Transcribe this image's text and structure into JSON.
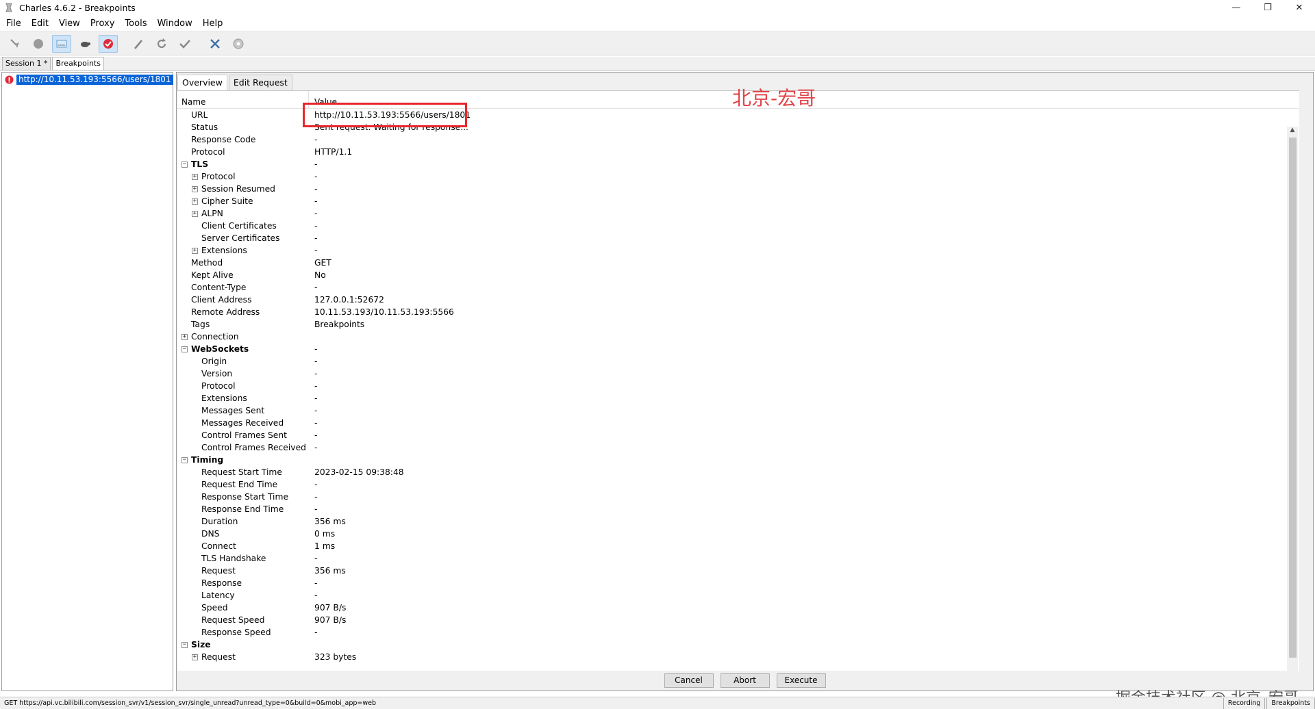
{
  "window": {
    "title": "Charles 4.6.2 - Breakpoints",
    "controls": [
      "minimize",
      "restore",
      "close"
    ]
  },
  "menu": [
    "File",
    "Edit",
    "View",
    "Proxy",
    "Tools",
    "Window",
    "Help"
  ],
  "toolbar": {
    "icons": [
      "broom-icon",
      "record-icon",
      "throttle-icon",
      "turtle-icon",
      "breakpoint-icon",
      "pen-icon",
      "refresh-icon",
      "check-icon",
      "tools-icon",
      "settings-icon"
    ]
  },
  "top_tabs": [
    "Session 1 *",
    "Breakpoints"
  ],
  "left_tree": {
    "url": "http://10.11.53.193:5566/users/1801"
  },
  "sub_tabs": [
    "Overview",
    "Edit Request"
  ],
  "table": {
    "name_header": "Name",
    "value_header": "Value",
    "rows": [
      {
        "name": "URL",
        "value": "http://10.11.53.193:5566/users/1801",
        "indent": 1,
        "expander": "none",
        "bold": false
      },
      {
        "name": "Status",
        "value": "Sent request. Waiting for response...",
        "indent": 1,
        "expander": "none",
        "bold": false
      },
      {
        "name": "Response Code",
        "value": "-",
        "indent": 1,
        "expander": "none",
        "bold": false
      },
      {
        "name": "Protocol",
        "value": "HTTP/1.1",
        "indent": 1,
        "expander": "none",
        "bold": false
      },
      {
        "name": "TLS",
        "value": "-",
        "indent": 0,
        "expander": "minus",
        "bold": true
      },
      {
        "name": "Protocol",
        "value": "-",
        "indent": 1,
        "expander": "plus",
        "bold": false
      },
      {
        "name": "Session Resumed",
        "value": "-",
        "indent": 1,
        "expander": "plus",
        "bold": false
      },
      {
        "name": "Cipher Suite",
        "value": "-",
        "indent": 1,
        "expander": "plus",
        "bold": false
      },
      {
        "name": "ALPN",
        "value": "-",
        "indent": 1,
        "expander": "plus",
        "bold": false
      },
      {
        "name": "Client Certificates",
        "value": "-",
        "indent": 2,
        "expander": "none",
        "bold": false
      },
      {
        "name": "Server Certificates",
        "value": "-",
        "indent": 2,
        "expander": "none",
        "bold": false
      },
      {
        "name": "Extensions",
        "value": "-",
        "indent": 1,
        "expander": "plus",
        "bold": false
      },
      {
        "name": "Method",
        "value": "GET",
        "indent": 1,
        "expander": "none",
        "bold": false
      },
      {
        "name": "Kept Alive",
        "value": "No",
        "indent": 1,
        "expander": "none",
        "bold": false
      },
      {
        "name": "Content-Type",
        "value": "-",
        "indent": 1,
        "expander": "none",
        "bold": false
      },
      {
        "name": "Client Address",
        "value": "127.0.0.1:52672",
        "indent": 1,
        "expander": "none",
        "bold": false
      },
      {
        "name": "Remote Address",
        "value": "10.11.53.193/10.11.53.193:5566",
        "indent": 1,
        "expander": "none",
        "bold": false
      },
      {
        "name": "Tags",
        "value": "Breakpoints",
        "indent": 1,
        "expander": "none",
        "bold": false
      },
      {
        "name": "Connection",
        "value": "",
        "indent": 0,
        "expander": "plus",
        "bold": false
      },
      {
        "name": "WebSockets",
        "value": "-",
        "indent": 0,
        "expander": "minus",
        "bold": true
      },
      {
        "name": "Origin",
        "value": "-",
        "indent": 2,
        "expander": "none",
        "bold": false
      },
      {
        "name": "Version",
        "value": "-",
        "indent": 2,
        "expander": "none",
        "bold": false
      },
      {
        "name": "Protocol",
        "value": "-",
        "indent": 2,
        "expander": "none",
        "bold": false
      },
      {
        "name": "Extensions",
        "value": "-",
        "indent": 2,
        "expander": "none",
        "bold": false
      },
      {
        "name": "Messages Sent",
        "value": "-",
        "indent": 2,
        "expander": "none",
        "bold": false
      },
      {
        "name": "Messages Received",
        "value": "-",
        "indent": 2,
        "expander": "none",
        "bold": false
      },
      {
        "name": "Control Frames Sent",
        "value": "-",
        "indent": 2,
        "expander": "none",
        "bold": false
      },
      {
        "name": "Control Frames Received",
        "value": "-",
        "indent": 2,
        "expander": "none",
        "bold": false
      },
      {
        "name": "Timing",
        "value": "",
        "indent": 0,
        "expander": "minus",
        "bold": true
      },
      {
        "name": "Request Start Time",
        "value": "2023-02-15 09:38:48",
        "indent": 2,
        "expander": "none",
        "bold": false
      },
      {
        "name": "Request End Time",
        "value": "-",
        "indent": 2,
        "expander": "none",
        "bold": false
      },
      {
        "name": "Response Start Time",
        "value": "-",
        "indent": 2,
        "expander": "none",
        "bold": false
      },
      {
        "name": "Response End Time",
        "value": "-",
        "indent": 2,
        "expander": "none",
        "bold": false
      },
      {
        "name": "Duration",
        "value": "356 ms",
        "indent": 2,
        "expander": "none",
        "bold": false
      },
      {
        "name": "DNS",
        "value": "0 ms",
        "indent": 2,
        "expander": "none",
        "bold": false
      },
      {
        "name": "Connect",
        "value": "1 ms",
        "indent": 2,
        "expander": "none",
        "bold": false
      },
      {
        "name": "TLS Handshake",
        "value": "-",
        "indent": 2,
        "expander": "none",
        "bold": false
      },
      {
        "name": "Request",
        "value": "356 ms",
        "indent": 2,
        "expander": "none",
        "bold": false
      },
      {
        "name": "Response",
        "value": "-",
        "indent": 2,
        "expander": "none",
        "bold": false
      },
      {
        "name": "Latency",
        "value": "-",
        "indent": 2,
        "expander": "none",
        "bold": false
      },
      {
        "name": "Speed",
        "value": "907 B/s",
        "indent": 2,
        "expander": "none",
        "bold": false
      },
      {
        "name": "Request Speed",
        "value": "907 B/s",
        "indent": 2,
        "expander": "none",
        "bold": false
      },
      {
        "name": "Response Speed",
        "value": "-",
        "indent": 2,
        "expander": "none",
        "bold": false
      },
      {
        "name": "Size",
        "value": "",
        "indent": 0,
        "expander": "minus",
        "bold": true
      },
      {
        "name": "Request",
        "value": "323 bytes",
        "indent": 1,
        "expander": "plus",
        "bold": false
      }
    ]
  },
  "buttons": {
    "cancel": "Cancel",
    "abort": "Abort",
    "execute": "Execute"
  },
  "watermarks": {
    "top": "北京-宏哥",
    "bottom": "掘金技术社区 @ 北京_宏哥"
  },
  "status_bar": {
    "text": "GET https://api.vc.bilibili.com/session_svr/v1/session_svr/single_unread?unread_type=0&build=0&mobi_app=web",
    "recording": "Recording",
    "breakpoints": "Breakpoints"
  },
  "colors": {
    "selection": "#0a64d8",
    "highlight_box": "#e8262a",
    "watermark_red": "#e14448"
  }
}
